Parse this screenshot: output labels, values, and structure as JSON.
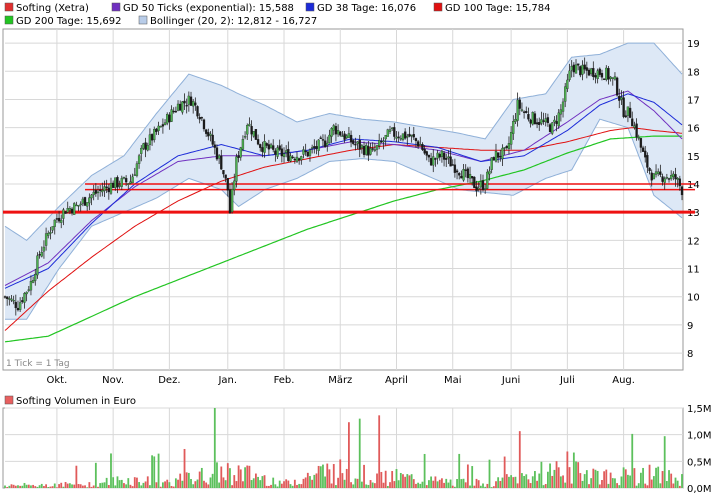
{
  "chart_data": [
    {
      "type": "candlestick",
      "legend": [
        {
          "label": "Softing (Xetra)",
          "color": "#e03030"
        },
        {
          "label": "GD 50 Ticks (exponential): 15,588",
          "color": "#7030c0"
        },
        {
          "label": "GD 38 Tage: 16,076",
          "color": "#1c2bd8"
        },
        {
          "label": "GD 100 Tage: 15,784",
          "color": "#e01010"
        },
        {
          "label": "GD 200 Tage: 15,692",
          "color": "#22c522"
        },
        {
          "label": "Bollinger (20, 2): 12,812 - 16,727",
          "color": "#b8cce8"
        }
      ],
      "note": "1 Tick = 1 Tag",
      "x_labels": [
        "Okt.",
        "Nov.",
        "Dez.",
        "Jan.",
        "Feb.",
        "März",
        "April",
        "Mai",
        "Juni",
        "Juli",
        "Aug."
      ],
      "y_ticks": [
        8,
        9,
        10,
        11,
        12,
        13,
        14,
        15,
        16,
        17,
        18,
        19
      ],
      "ylim": [
        7.4,
        19.5
      ],
      "grid": true,
      "price_keypoints": [
        [
          0,
          10.0
        ],
        [
          6,
          9.7
        ],
        [
          12,
          10.5
        ],
        [
          16,
          11.5
        ],
        [
          22,
          12.6
        ],
        [
          28,
          13.1
        ],
        [
          33,
          13.2
        ],
        [
          40,
          13.6
        ],
        [
          50,
          14.0
        ],
        [
          58,
          14.1
        ],
        [
          64,
          15.3
        ],
        [
          72,
          16.0
        ],
        [
          80,
          16.8
        ],
        [
          86,
          17.0
        ],
        [
          90,
          16.5
        ],
        [
          95,
          15.6
        ],
        [
          100,
          14.7
        ],
        [
          103,
          13.8
        ],
        [
          104,
          13.0
        ],
        [
          107,
          14.8
        ],
        [
          112,
          16.2
        ],
        [
          118,
          15.4
        ],
        [
          125,
          15.1
        ],
        [
          133,
          15.0
        ],
        [
          140,
          15.1
        ],
        [
          148,
          15.5
        ],
        [
          152,
          16.0
        ],
        [
          157,
          15.7
        ],
        [
          162,
          15.4
        ],
        [
          170,
          15.1
        ],
        [
          178,
          15.8
        ],
        [
          187,
          15.7
        ],
        [
          192,
          15.4
        ],
        [
          196,
          14.8
        ],
        [
          202,
          15.0
        ],
        [
          210,
          14.5
        ],
        [
          218,
          13.9
        ],
        [
          222,
          14.0
        ],
        [
          226,
          15.0
        ],
        [
          232,
          15.1
        ],
        [
          237,
          16.8
        ],
        [
          242,
          16.4
        ],
        [
          248,
          16.2
        ],
        [
          253,
          16.0
        ],
        [
          257,
          16.6
        ],
        [
          262,
          18.2
        ],
        [
          267,
          18.0
        ],
        [
          273,
          18.0
        ],
        [
          278,
          17.9
        ],
        [
          282,
          17.6
        ],
        [
          286,
          16.6
        ],
        [
          289,
          16.5
        ],
        [
          292,
          15.8
        ],
        [
          296,
          14.8
        ],
        [
          300,
          14.2
        ],
        [
          305,
          14.3
        ],
        [
          310,
          14.2
        ],
        [
          313,
          13.8
        ]
      ],
      "bollinger_upper_keypoints": [
        [
          0,
          12.5
        ],
        [
          10,
          12.0
        ],
        [
          25,
          13.2
        ],
        [
          40,
          14.3
        ],
        [
          55,
          15.0
        ],
        [
          70,
          16.5
        ],
        [
          85,
          17.9
        ],
        [
          100,
          17.5
        ],
        [
          108,
          17.2
        ],
        [
          120,
          16.8
        ],
        [
          135,
          16.2
        ],
        [
          150,
          16.5
        ],
        [
          165,
          16.3
        ],
        [
          180,
          16.2
        ],
        [
          195,
          16.0
        ],
        [
          210,
          15.8
        ],
        [
          222,
          15.6
        ],
        [
          235,
          17.0
        ],
        [
          250,
          17.2
        ],
        [
          262,
          18.5
        ],
        [
          275,
          18.6
        ],
        [
          288,
          19.0
        ],
        [
          300,
          19.0
        ],
        [
          313,
          17.9
        ]
      ],
      "bollinger_lower_keypoints": [
        [
          0,
          9.2
        ],
        [
          10,
          9.2
        ],
        [
          25,
          11.0
        ],
        [
          40,
          12.5
        ],
        [
          55,
          13.0
        ],
        [
          70,
          13.5
        ],
        [
          85,
          14.2
        ],
        [
          100,
          13.8
        ],
        [
          108,
          13.2
        ],
        [
          120,
          13.8
        ],
        [
          135,
          14.2
        ],
        [
          150,
          14.8
        ],
        [
          165,
          14.9
        ],
        [
          180,
          14.8
        ],
        [
          195,
          14.3
        ],
        [
          210,
          13.8
        ],
        [
          222,
          13.7
        ],
        [
          235,
          13.6
        ],
        [
          250,
          14.2
        ],
        [
          262,
          14.5
        ],
        [
          275,
          16.3
        ],
        [
          288,
          16.0
        ],
        [
          300,
          13.6
        ],
        [
          313,
          12.8
        ]
      ],
      "gd38_keypoints": [
        [
          0,
          10.3
        ],
        [
          20,
          11.0
        ],
        [
          40,
          12.6
        ],
        [
          60,
          14.0
        ],
        [
          80,
          15.0
        ],
        [
          100,
          15.4
        ],
        [
          120,
          15.0
        ],
        [
          140,
          15.2
        ],
        [
          160,
          15.6
        ],
        [
          180,
          15.5
        ],
        [
          200,
          15.3
        ],
        [
          220,
          14.8
        ],
        [
          240,
          15.0
        ],
        [
          260,
          15.9
        ],
        [
          275,
          16.8
        ],
        [
          288,
          17.2
        ],
        [
          300,
          16.9
        ],
        [
          313,
          16.1
        ]
      ],
      "gd50_keypoints": [
        [
          0,
          10.4
        ],
        [
          20,
          11.2
        ],
        [
          40,
          12.7
        ],
        [
          60,
          13.9
        ],
        [
          80,
          14.8
        ],
        [
          100,
          15.0
        ],
        [
          120,
          15.0
        ],
        [
          140,
          15.2
        ],
        [
          160,
          15.5
        ],
        [
          180,
          15.4
        ],
        [
          200,
          15.2
        ],
        [
          220,
          14.8
        ],
        [
          240,
          15.2
        ],
        [
          260,
          16.2
        ],
        [
          275,
          17.0
        ],
        [
          288,
          17.3
        ],
        [
          300,
          16.6
        ],
        [
          313,
          15.6
        ]
      ],
      "gd100_keypoints": [
        [
          0,
          8.8
        ],
        [
          20,
          10.2
        ],
        [
          40,
          11.4
        ],
        [
          60,
          12.5
        ],
        [
          80,
          13.4
        ],
        [
          100,
          14.1
        ],
        [
          120,
          14.6
        ],
        [
          140,
          14.9
        ],
        [
          160,
          15.2
        ],
        [
          180,
          15.4
        ],
        [
          200,
          15.3
        ],
        [
          220,
          15.2
        ],
        [
          240,
          15.2
        ],
        [
          260,
          15.5
        ],
        [
          280,
          15.9
        ],
        [
          290,
          16.0
        ],
        [
          300,
          15.9
        ],
        [
          313,
          15.8
        ]
      ],
      "gd200_keypoints": [
        [
          0,
          8.4
        ],
        [
          20,
          8.6
        ],
        [
          40,
          9.3
        ],
        [
          60,
          10.0
        ],
        [
          80,
          10.6
        ],
        [
          100,
          11.2
        ],
        [
          120,
          11.8
        ],
        [
          140,
          12.4
        ],
        [
          160,
          12.9
        ],
        [
          180,
          13.4
        ],
        [
          200,
          13.8
        ],
        [
          220,
          14.1
        ],
        [
          240,
          14.5
        ],
        [
          260,
          15.1
        ],
        [
          280,
          15.6
        ],
        [
          300,
          15.7
        ],
        [
          313,
          15.7
        ]
      ],
      "horizontal_lines": [
        14.0,
        13.8,
        13.0
      ]
    },
    {
      "type": "bar",
      "title": "Softing Volumen in Euro",
      "y_ticks": [
        "0,0M",
        "0,5M",
        "1,0M",
        "1,5M"
      ],
      "ylim": [
        0,
        1.5
      ],
      "volume_keypoints": [
        [
          0,
          0.15
        ],
        [
          40,
          0.25
        ],
        [
          55,
          0.5
        ],
        [
          75,
          0.35
        ],
        [
          105,
          1.05
        ],
        [
          130,
          0.3
        ],
        [
          150,
          1.1
        ],
        [
          170,
          0.8
        ],
        [
          200,
          0.4
        ],
        [
          225,
          0.3
        ],
        [
          240,
          0.7
        ],
        [
          262,
          1.3
        ],
        [
          280,
          0.6
        ],
        [
          295,
          0.9
        ],
        [
          313,
          0.5
        ]
      ]
    }
  ]
}
